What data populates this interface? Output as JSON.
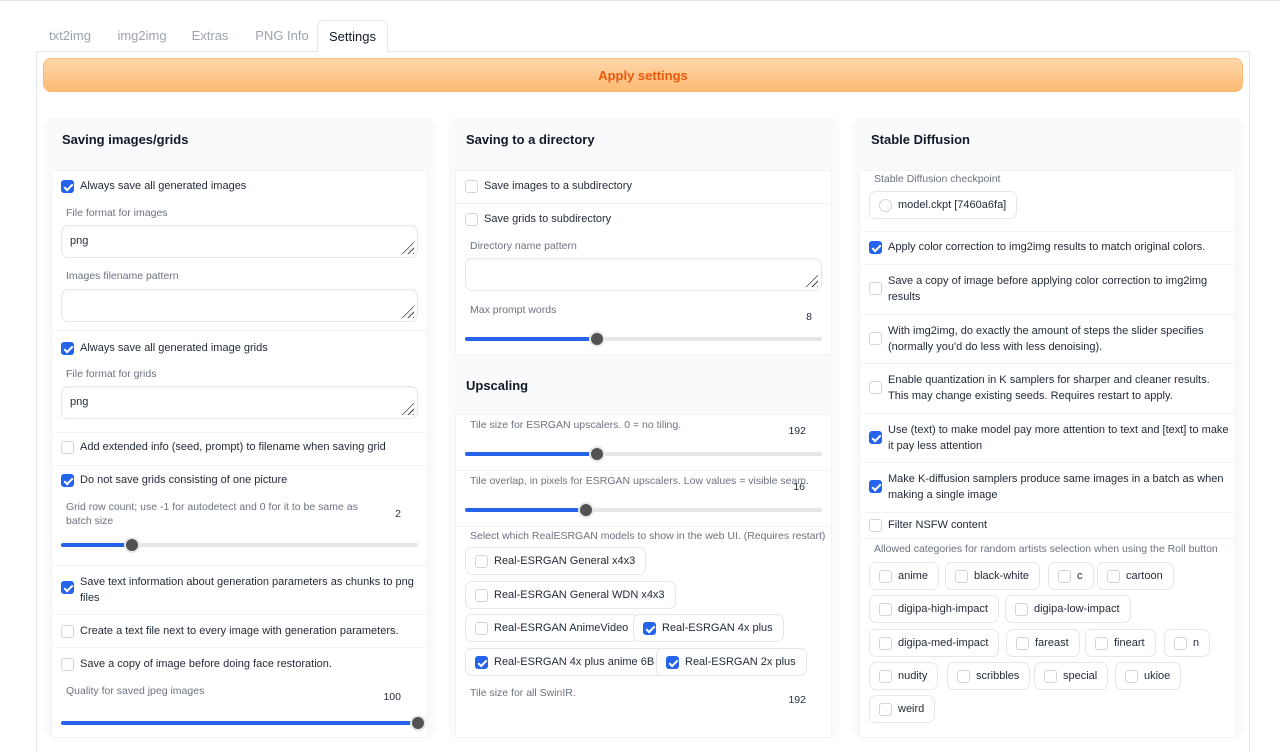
{
  "tabs": [
    "txt2img",
    "img2img",
    "Extras",
    "PNG Info",
    "Settings"
  ],
  "apply_button": "Apply settings",
  "col1": {
    "title": "Saving images/grids",
    "always_save_images": "Always save all generated images",
    "file_format_images_label": "File format for images",
    "file_format_images_value": "png",
    "filename_pattern_label": "Images filename pattern",
    "filename_pattern_value": "",
    "always_save_grids": "Always save all generated image grids",
    "file_format_grids_label": "File format for grids",
    "file_format_grids_value": "png",
    "add_extended_info": "Add extended info (seed, prompt) to filename when saving grid",
    "no_single_grid": "Do not save grids consisting of one picture",
    "grid_row_count_label": "Grid row count; use -1 for autodetect and 0 for it to be same as batch size",
    "grid_row_count_value": "2",
    "grid_row_count_fraction": 0.2,
    "save_text_info": "Save text information about generation parameters as chunks to png files",
    "create_text_file": "Create a text file next to every image with generation parameters.",
    "save_before_face": "Save a copy of image before doing face restoration.",
    "jpeg_quality_label": "Quality for saved jpeg images",
    "jpeg_quality_value": "100",
    "jpeg_quality_fraction": 1.0
  },
  "col2": {
    "title": "Saving to a directory",
    "save_to_subdir": "Save images to a subdirectory",
    "save_grids_subdir": "Save grids to subdirectory",
    "dir_pattern_label": "Directory name pattern",
    "dir_pattern_value": "",
    "max_prompt_words_label": "Max prompt words",
    "max_prompt_words_value": "8",
    "max_prompt_words_fraction": 0.37,
    "upscaling_title": "Upscaling",
    "tile_size_label": "Tile size for ESRGAN upscalers. 0 = no tiling.",
    "tile_size_value": "192",
    "tile_size_fraction": 0.37,
    "tile_overlap_label": "Tile overlap, in pixels for ESRGAN upscalers. Low values = visible seam.",
    "tile_overlap_value": "16",
    "tile_overlap_fraction": 0.34,
    "realesrgan_label": "Select which RealESRGAN models to show in the web UI. (Requires restart)",
    "realesrgan_models": [
      {
        "label": "Real-ESRGAN General x4x3",
        "checked": false
      },
      {
        "label": "Real-ESRGAN General WDN x4x3",
        "checked": false
      },
      {
        "label": "Real-ESRGAN AnimeVideo",
        "checked": false
      },
      {
        "label": "Real-ESRGAN 4x plus",
        "checked": true
      },
      {
        "label": "Real-ESRGAN 4x plus anime 6B",
        "checked": true
      },
      {
        "label": "Real-ESRGAN 2x plus",
        "checked": true
      }
    ],
    "swinir_tile_label": "Tile size for all SwinIR.",
    "swinir_tile_value": "192"
  },
  "col3": {
    "title": "Stable Diffusion",
    "checkpoint_label": "Stable Diffusion checkpoint",
    "checkpoint_value": "model.ckpt [7460a6fa]",
    "color_correction": "Apply color correction to img2img results to match original colors.",
    "save_before_color": "Save a copy of image before applying color correction to img2img results",
    "exact_steps": "With img2img, do exactly the amount of steps the slider specifies (normally you'd do less with less denoising).",
    "quantization": "Enable quantization in K samplers for sharper and cleaner results. This may change existing seeds. Requires restart to apply.",
    "attention": "Use (text) to make model pay more attention to text and [text] to make it pay less attention",
    "k_diffusion_batch": "Make K-diffusion samplers produce same images in a batch as when making a single image",
    "filter_nsfw": "Filter NSFW content",
    "artists_label": "Allowed categories for random artists selection when using the Roll button",
    "artist_categories": [
      "anime",
      "black-white",
      "c",
      "cartoon",
      "digipa-high-impact",
      "digipa-low-impact",
      "digipa-med-impact",
      "fareast",
      "fineart",
      "n",
      "nudity",
      "scribbles",
      "special",
      "ukioe",
      "weird"
    ]
  }
}
